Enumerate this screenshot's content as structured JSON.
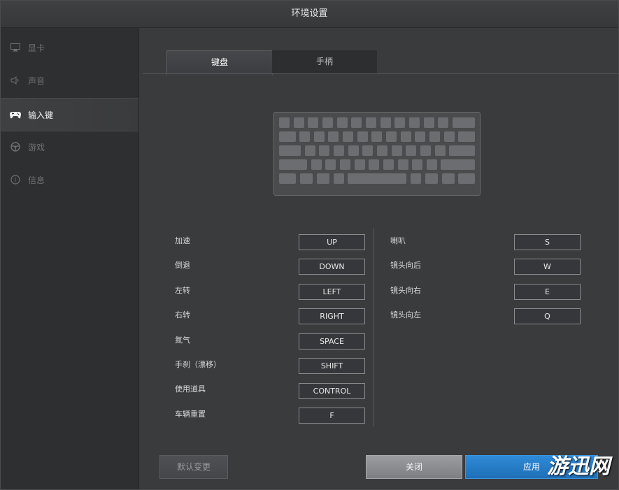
{
  "window": {
    "title": "环境设置"
  },
  "sidebar": {
    "items": [
      {
        "label": "显卡",
        "icon": "monitor-icon",
        "active": false
      },
      {
        "label": "声音",
        "icon": "speaker-icon",
        "active": false
      },
      {
        "label": "输入键",
        "icon": "gamepad-icon",
        "active": true
      },
      {
        "label": "游戏",
        "icon": "steering-wheel-icon",
        "active": false
      },
      {
        "label": "信息",
        "icon": "info-icon",
        "active": false
      }
    ]
  },
  "tabs": [
    {
      "label": "键盘",
      "active": true
    },
    {
      "label": "手柄",
      "active": false
    }
  ],
  "bindings_left": [
    {
      "label": "加速",
      "key": "UP"
    },
    {
      "label": "倒退",
      "key": "DOWN"
    },
    {
      "label": "左转",
      "key": "LEFT"
    },
    {
      "label": "右转",
      "key": "RIGHT"
    },
    {
      "label": "氮气",
      "key": "SPACE"
    },
    {
      "label": "手刹（漂移）",
      "key": "SHIFT"
    },
    {
      "label": "使用道具",
      "key": "CONTROL"
    },
    {
      "label": "车辆重置",
      "key": "F"
    }
  ],
  "bindings_right": [
    {
      "label": "喇叭",
      "key": "S"
    },
    {
      "label": "镜头向后",
      "key": "W"
    },
    {
      "label": "镜头向右",
      "key": "E"
    },
    {
      "label": "镜头向左",
      "key": "Q"
    }
  ],
  "buttons": {
    "default_label": "默认变更",
    "close_label": "关闭",
    "apply_label": "应用"
  },
  "watermark": "游迅网",
  "colors": {
    "accent": "#1f6fb8",
    "background": "#3a3b3d",
    "sidebar": "#2e2f31"
  }
}
